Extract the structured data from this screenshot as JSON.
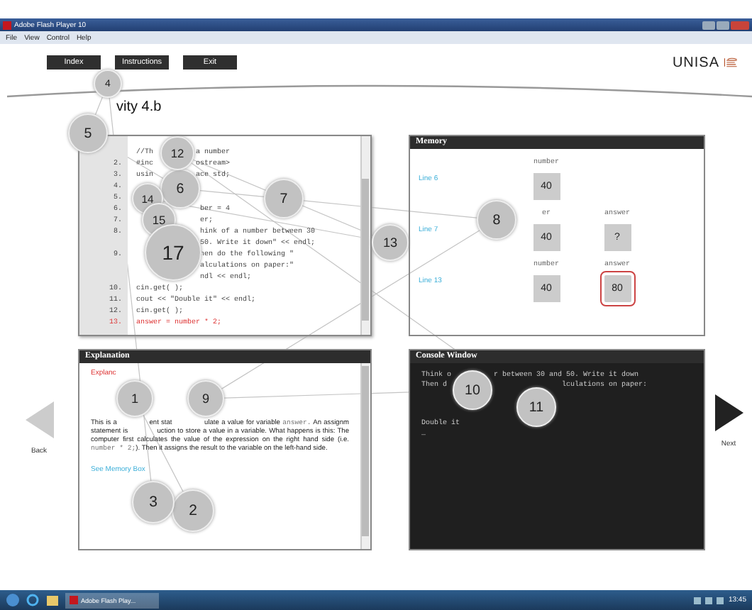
{
  "window": {
    "title": "Adobe Flash Player 10"
  },
  "menu": [
    "File",
    "View",
    "Control",
    "Help"
  ],
  "nav_buttons": [
    "Index",
    "Instructions",
    "Exit"
  ],
  "logo": {
    "text": "UNISA"
  },
  "activity_title": "vity 4.b",
  "code": {
    "lines": [
      {
        "text": "//Th          a number",
        "current": false
      },
      {
        "num": "2.",
        "text": "#inc          ostream>",
        "current": false
      },
      {
        "num": "3.",
        "text": "usin          ace std;",
        "current": false
      },
      {
        "num": "4.",
        "current": false
      },
      {
        "num": "5.",
        "current": false
      },
      {
        "num": "6.",
        "text": "               ber = 4",
        "current": false
      },
      {
        "num": "7.",
        "text": "               er;",
        "current": false
      },
      {
        "num": "8.",
        "text": "               hink of a number between 30",
        "current": false
      },
      {
        "text": "               50. Write it down\" << endl;",
        "current": false
      },
      {
        "num": "9.",
        "text": "               hen do the following \"",
        "current": false
      },
      {
        "text": "               alculations on paper:\"",
        "current": false
      },
      {
        "text": "               ndl << endl;",
        "current": false
      },
      {
        "num": "10.",
        "text": "cin.get( );",
        "current": false
      },
      {
        "num": "11.",
        "text": "cout << \"Double it\" << endl;",
        "current": false
      },
      {
        "num": "12.",
        "text": "cin.get( );",
        "current": false
      },
      {
        "num": "13.",
        "text": "answer = number * 2;",
        "current": true
      }
    ]
  },
  "memory": {
    "title": "Memory",
    "rows": [
      {
        "line": "Line 6",
        "cells": [
          {
            "label": "number",
            "value": "40",
            "circled": false
          }
        ]
      },
      {
        "line": "Line 7",
        "cells": [
          {
            "label": "er",
            "value": "40",
            "circled": false
          },
          {
            "label": "answer",
            "value": "?",
            "circled": false
          }
        ]
      },
      {
        "line": "Line 13",
        "cells": [
          {
            "label": "number",
            "value": "40",
            "circled": false
          },
          {
            "label": "answer",
            "value": "80",
            "circled": true
          }
        ]
      }
    ]
  },
  "back": {
    "label": "Back"
  },
  "next": {
    "label": "Next"
  },
  "explanation": {
    "title": "Explanation",
    "heading": "Explanc",
    "paragraph": [
      {
        "kind": "text",
        "text": "This is a              ent stat              ulate a value for variable "
      },
      {
        "kind": "code",
        "text": "answer."
      },
      {
        "kind": "text",
        "text": " An assignm     statement is             uction to store a value in a variable. What happens is this: The computer first calculates the value of the expression on the right hand side (i.e. "
      },
      {
        "kind": "code",
        "text": "number * 2;"
      },
      {
        "kind": "text",
        "text": "). Then it assigns the result to the variable on the left-hand side."
      }
    ],
    "link": "See Memory Box"
  },
  "console": {
    "title": "Console Window",
    "blocks": [
      [
        "Think o          r between 30 and 50. Write it down",
        "Then d                           lculations on paper:"
      ],
      [
        "Double it"
      ]
    ],
    "cursor": "_"
  },
  "markers": [
    "1",
    "2",
    "3",
    "4",
    "5",
    "6",
    "7",
    "8",
    "9",
    "10",
    "11",
    "12",
    "13",
    "14",
    "15",
    "17"
  ],
  "taskbar": {
    "app": "Adobe Flash Play...",
    "clock": "13:45"
  }
}
